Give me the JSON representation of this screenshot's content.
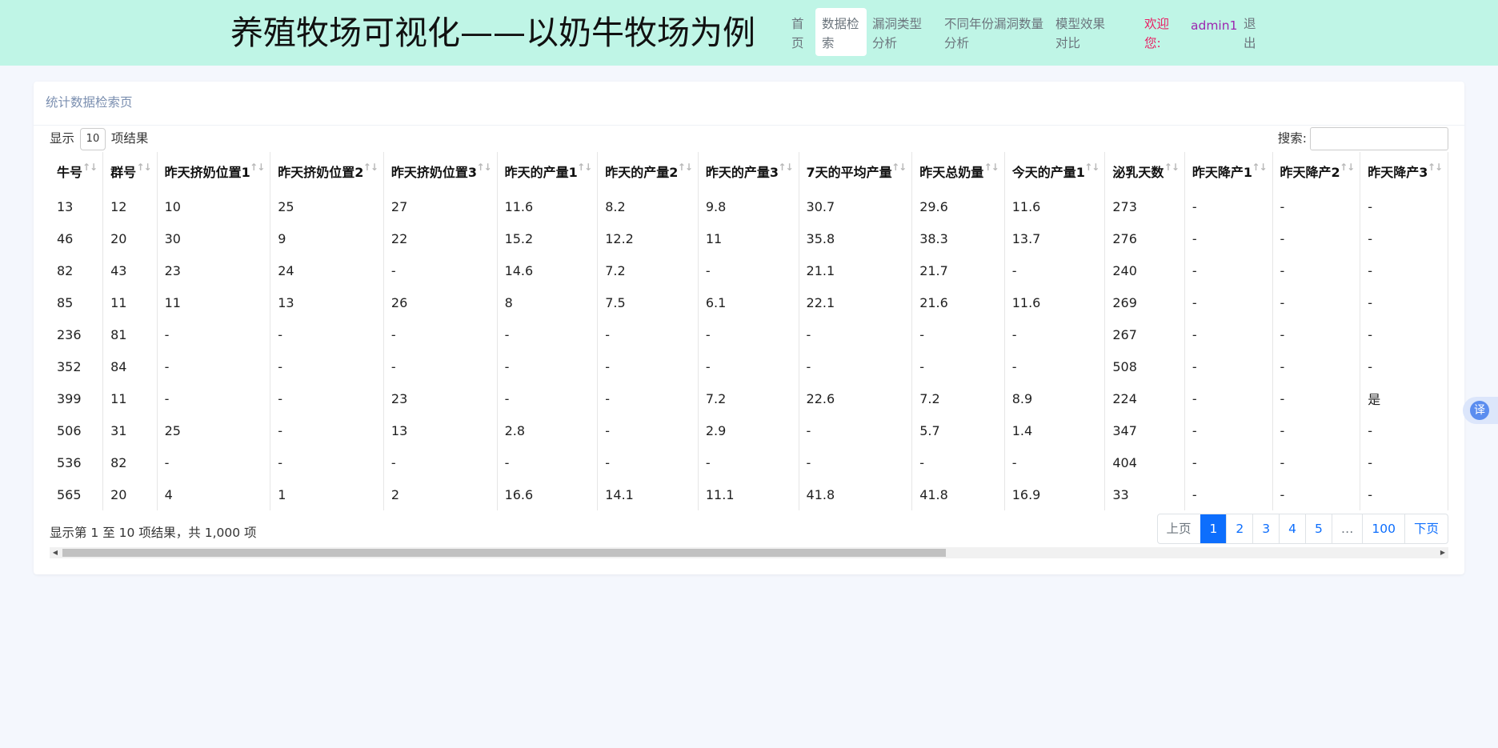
{
  "header": {
    "title": "养殖牧场可视化——以奶牛牧场为例",
    "nav": [
      {
        "label": "首页"
      },
      {
        "label": "数据检索"
      },
      {
        "label": "漏洞类型分析"
      },
      {
        "label": "不同年份漏洞数量分析"
      },
      {
        "label": "模型效果对比"
      }
    ],
    "welcome": "欢迎您:",
    "username": "admin1",
    "logout": "退出"
  },
  "card": {
    "title": "统计数据检索页",
    "length_prefix": "显示",
    "length_value": "10",
    "length_suffix": "项结果",
    "search_label": "搜索:"
  },
  "table": {
    "columns": [
      "牛号",
      "群号",
      "昨天挤奶位置1",
      "昨天挤奶位置2",
      "昨天挤奶位置3",
      "昨天的产量1",
      "昨天的产量2",
      "昨天的产量3",
      "7天的平均产量",
      "昨天总奶量",
      "今天的产量1",
      "泌乳天数",
      "昨天降产1",
      "昨天降产2",
      "昨天降产3"
    ],
    "rows": [
      [
        "13",
        "12",
        "10",
        "25",
        "27",
        "11.6",
        "8.2",
        "9.8",
        "30.7",
        "29.6",
        "11.6",
        "273",
        "-",
        "-",
        "-"
      ],
      [
        "46",
        "20",
        "30",
        "9",
        "22",
        "15.2",
        "12.2",
        "11",
        "35.8",
        "38.3",
        "13.7",
        "276",
        "-",
        "-",
        "-"
      ],
      [
        "82",
        "43",
        "23",
        "24",
        "-",
        "14.6",
        "7.2",
        "-",
        "21.1",
        "21.7",
        "-",
        "240",
        "-",
        "-",
        "-"
      ],
      [
        "85",
        "11",
        "11",
        "13",
        "26",
        "8",
        "7.5",
        "6.1",
        "22.1",
        "21.6",
        "11.6",
        "269",
        "-",
        "-",
        "-"
      ],
      [
        "236",
        "81",
        "-",
        "-",
        "-",
        "-",
        "-",
        "-",
        "-",
        "-",
        "-",
        "267",
        "-",
        "-",
        "-"
      ],
      [
        "352",
        "84",
        "-",
        "-",
        "-",
        "-",
        "-",
        "-",
        "-",
        "-",
        "-",
        "508",
        "-",
        "-",
        "-"
      ],
      [
        "399",
        "11",
        "-",
        "-",
        "23",
        "-",
        "-",
        "7.2",
        "22.6",
        "7.2",
        "8.9",
        "224",
        "-",
        "-",
        "是"
      ],
      [
        "506",
        "31",
        "25",
        "-",
        "13",
        "2.8",
        "-",
        "2.9",
        "-",
        "5.7",
        "1.4",
        "347",
        "-",
        "-",
        "-"
      ],
      [
        "536",
        "82",
        "-",
        "-",
        "-",
        "-",
        "-",
        "-",
        "-",
        "-",
        "-",
        "404",
        "-",
        "-",
        "-"
      ],
      [
        "565",
        "20",
        "4",
        "1",
        "2",
        "16.6",
        "14.1",
        "11.1",
        "41.8",
        "41.8",
        "16.9",
        "33",
        "-",
        "-",
        "-"
      ]
    ]
  },
  "footer": {
    "info": "显示第 1 至 10 项结果，共 1,000 项",
    "pager": [
      "上页",
      "1",
      "2",
      "3",
      "4",
      "5",
      "…",
      "100",
      "下页"
    ],
    "current_page": "1"
  },
  "translate_label": "译"
}
